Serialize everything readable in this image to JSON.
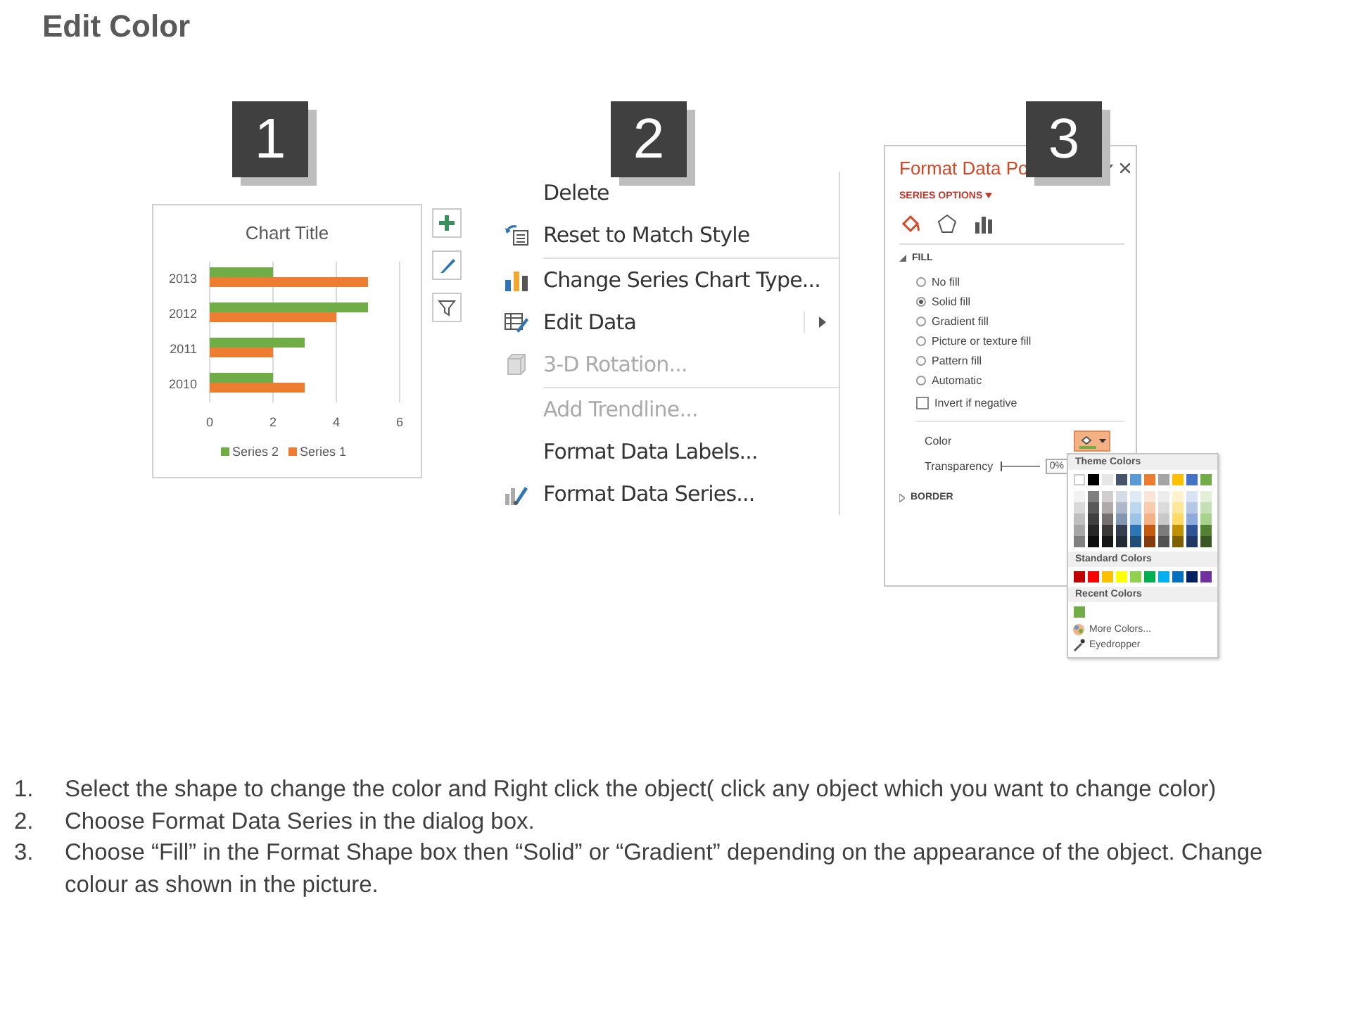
{
  "title": "Edit Color",
  "chart_panel": {
    "badge": "1",
    "chart_data": {
      "type": "bar",
      "orientation": "horizontal",
      "title": "Chart Title",
      "categories": [
        "2013",
        "2012",
        "2011",
        "2010"
      ],
      "series": [
        {
          "name": "Series 2",
          "color": "#70ad47",
          "values": [
            2,
            5,
            3,
            2
          ]
        },
        {
          "name": "Series 1",
          "color": "#ed7d31",
          "values": [
            5,
            4,
            2,
            3
          ]
        }
      ],
      "xlim": [
        0,
        6
      ],
      "xticks": [
        0,
        2,
        4,
        6
      ],
      "legend": true
    }
  },
  "menu_panel": {
    "badge": "2",
    "items": [
      {
        "kind": "plain",
        "label": "Delete",
        "disabled": false,
        "submenu": false
      },
      {
        "kind": "reset",
        "label": "Reset to Match Style",
        "disabled": false,
        "submenu": false
      },
      {
        "kind": "separator"
      },
      {
        "kind": "chart-type",
        "label": "Change Series Chart Type...",
        "disabled": false,
        "submenu": false
      },
      {
        "kind": "edit-data",
        "label": "Edit Data",
        "disabled": false,
        "submenu": true
      },
      {
        "kind": "rotation",
        "label": "3-D Rotation...",
        "disabled": true,
        "submenu": false
      },
      {
        "kind": "separator"
      },
      {
        "kind": "plain",
        "label": "Add Trendline...",
        "disabled": true,
        "submenu": false
      },
      {
        "kind": "plain",
        "label": "Format Data Labels...",
        "disabled": false,
        "submenu": false
      },
      {
        "kind": "format-series",
        "label": "Format Data Series...",
        "disabled": false,
        "submenu": false
      }
    ]
  },
  "format_pane": {
    "badge": "3",
    "title": "Format Data Po",
    "section": "SERIES OPTIONS",
    "tabs": [
      {
        "kind": "fill",
        "selected": true
      },
      {
        "kind": "effects",
        "selected": false
      },
      {
        "kind": "series",
        "selected": false
      }
    ],
    "fill": {
      "label": "FILL",
      "expanded": true,
      "options": [
        {
          "label": "No fill",
          "selected": false
        },
        {
          "label": "Solid fill",
          "selected": true
        },
        {
          "label": "Gradient fill",
          "selected": false
        },
        {
          "label": "Picture or texture fill",
          "selected": false
        },
        {
          "label": "Pattern fill",
          "selected": false
        },
        {
          "label": "Automatic",
          "selected": false
        }
      ],
      "invert": {
        "label": "Invert if negative",
        "checked": false
      },
      "color_label": "Color",
      "color_button": {
        "color": "#70ad47"
      },
      "transparency": {
        "label": "Transparency",
        "level": 0,
        "value": "0%"
      }
    },
    "border": {
      "label": "BORDER",
      "expanded": false
    },
    "palette": {
      "theme_label": "Theme Colors",
      "theme": [
        {
          "color": "#ffffff",
          "shades": [
            {
              "color": "#f2f2f2"
            },
            {
              "color": "#d9d9d9"
            },
            {
              "color": "#bfbfbf"
            },
            {
              "color": "#a6a6a6"
            },
            {
              "color": "#808080"
            }
          ]
        },
        {
          "color": "#000000",
          "shades": [
            {
              "color": "#7f7f7f"
            },
            {
              "color": "#595959"
            },
            {
              "color": "#404040"
            },
            {
              "color": "#262626"
            },
            {
              "color": "#0d0d0d"
            }
          ]
        },
        {
          "color": "#e7e6e6",
          "shades": [
            {
              "color": "#d0cece"
            },
            {
              "color": "#afabab"
            },
            {
              "color": "#767171"
            },
            {
              "color": "#3b3838"
            },
            {
              "color": "#171616"
            }
          ]
        },
        {
          "color": "#44546a",
          "shades": [
            {
              "color": "#d6dce5"
            },
            {
              "color": "#adb9ca"
            },
            {
              "color": "#8497b0"
            },
            {
              "color": "#333f50"
            },
            {
              "color": "#222a35"
            }
          ]
        },
        {
          "color": "#5b9bd5",
          "shades": [
            {
              "color": "#deebf7"
            },
            {
              "color": "#bdd7ee"
            },
            {
              "color": "#9dc3e6"
            },
            {
              "color": "#2e75b6"
            },
            {
              "color": "#1f4e79"
            }
          ]
        },
        {
          "color": "#ed7d31",
          "shades": [
            {
              "color": "#fbe5d6"
            },
            {
              "color": "#f8cbad"
            },
            {
              "color": "#f4b183"
            },
            {
              "color": "#c55a11"
            },
            {
              "color": "#843c0c"
            }
          ]
        },
        {
          "color": "#a5a5a5",
          "shades": [
            {
              "color": "#ededed"
            },
            {
              "color": "#dbdbdb"
            },
            {
              "color": "#c9c9c9"
            },
            {
              "color": "#7b7b7b"
            },
            {
              "color": "#525252"
            }
          ]
        },
        {
          "color": "#ffc000",
          "shades": [
            {
              "color": "#fff2cc"
            },
            {
              "color": "#ffe699"
            },
            {
              "color": "#ffd966"
            },
            {
              "color": "#bf9000"
            },
            {
              "color": "#7f6000"
            }
          ]
        },
        {
          "color": "#4472c4",
          "shades": [
            {
              "color": "#dae3f3"
            },
            {
              "color": "#b4c7e7"
            },
            {
              "color": "#8faadc"
            },
            {
              "color": "#2f5597"
            },
            {
              "color": "#203864"
            }
          ]
        },
        {
          "color": "#70ad47",
          "shades": [
            {
              "color": "#e2f0d9"
            },
            {
              "color": "#c5e0b4"
            },
            {
              "color": "#a9d18e"
            },
            {
              "color": "#548235"
            },
            {
              "color": "#385723"
            }
          ]
        }
      ],
      "standard_label": "Standard Colors",
      "standard": [
        {
          "color": "#c00000"
        },
        {
          "color": "#ff0000"
        },
        {
          "color": "#ffc000"
        },
        {
          "color": "#ffff00"
        },
        {
          "color": "#92d050"
        },
        {
          "color": "#00b050"
        },
        {
          "color": "#00b0f0"
        },
        {
          "color": "#0070c0"
        },
        {
          "color": "#002060"
        },
        {
          "color": "#7030a0"
        }
      ],
      "recent_label": "Recent Colors",
      "recent": [
        {
          "color": "#70ad47"
        }
      ],
      "actions": [
        {
          "kind": "more",
          "label": "More Colors..."
        },
        {
          "kind": "eyedropper",
          "label": "Eyedropper"
        }
      ]
    }
  },
  "instructions": [
    {
      "number": "1.",
      "text": "Select the shape to change the color and Right click the object( click any object which you want to change color)"
    },
    {
      "number": "2.",
      "text": "Choose Format Data Series in the dialog box."
    },
    {
      "number": "3.",
      "text": "Choose “Fill” in the Format Shape box then “Solid” or “Gradient” depending on the appearance of the object. Change colour as shown in the picture."
    }
  ]
}
